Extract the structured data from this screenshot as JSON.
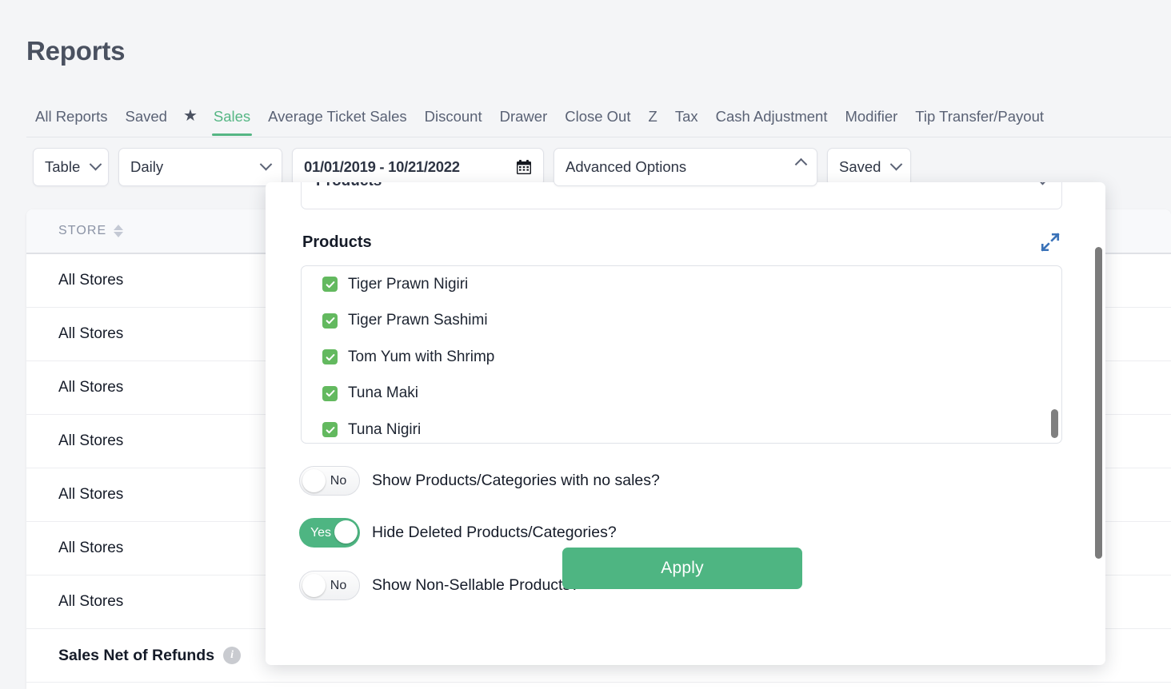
{
  "page": {
    "title": "Reports"
  },
  "tabs": [
    {
      "label": "All Reports",
      "active": false
    },
    {
      "label": "Saved",
      "active": false
    },
    {
      "label": "★",
      "active": false,
      "icon": "star-icon"
    },
    {
      "label": "Sales",
      "active": true
    },
    {
      "label": "Average Ticket Sales",
      "active": false
    },
    {
      "label": "Discount",
      "active": false
    },
    {
      "label": "Drawer",
      "active": false
    },
    {
      "label": "Close Out",
      "active": false
    },
    {
      "label": "Z",
      "active": false
    },
    {
      "label": "Tax",
      "active": false
    },
    {
      "label": "Cash Adjustment",
      "active": false
    },
    {
      "label": "Modifier",
      "active": false
    },
    {
      "label": "Tip Transfer/Payout",
      "active": false
    }
  ],
  "toolbar": {
    "view_type": "Table",
    "interval": "Daily",
    "date_range": "01/01/2019 - 10/21/2022",
    "advanced_options": "Advanced Options",
    "saved": "Saved"
  },
  "table": {
    "columns": [
      "STORE"
    ],
    "rows": [
      "All Stores",
      "All Stores",
      "All Stores",
      "All Stores",
      "All Stores",
      "All Stores",
      "All Stores"
    ],
    "total_row": {
      "label": "Sales Net of Refunds"
    }
  },
  "modal": {
    "select_value": "Products",
    "section_title": "Products",
    "products": [
      {
        "name": "Tiger Prawn Nigiri",
        "checked": true
      },
      {
        "name": "Tiger Prawn Sashimi",
        "checked": true
      },
      {
        "name": "Tom Yum with Shrimp",
        "checked": true
      },
      {
        "name": "Tuna Maki",
        "checked": true
      },
      {
        "name": "Tuna Nigiri",
        "checked": true
      }
    ],
    "toggles": [
      {
        "value": "No",
        "on": false,
        "label": "Show Products/Categories with no sales?"
      },
      {
        "value": "Yes",
        "on": true,
        "label": "Hide Deleted Products/Categories?"
      },
      {
        "value": "No",
        "on": false,
        "label": "Show Non-Sellable Products?"
      }
    ],
    "apply_label": "Apply"
  },
  "colors": {
    "accent_green": "#4eb582",
    "checkbox_green": "#63b95f",
    "title_gray": "#4a5160",
    "expand_blue": "#3a72b8"
  }
}
